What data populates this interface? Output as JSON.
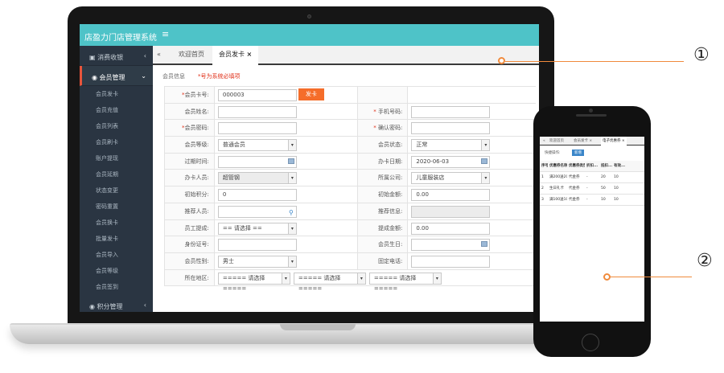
{
  "app": {
    "title": "店盈力门店管理系统",
    "menu_icon": "≡"
  },
  "sidebar": {
    "groups": [
      {
        "label": "消费收银",
        "chev": "‹"
      },
      {
        "label": "会员管理",
        "chev": "⌄"
      },
      {
        "label": "积分管理",
        "chev": "‹"
      }
    ],
    "items": [
      "会员发卡",
      "会员充值",
      "会员列表",
      "会员刷卡",
      "账户提现",
      "会员延期",
      "状态变更",
      "密码重置",
      "会员换卡",
      "批量发卡",
      "会员导入",
      "会员等级",
      "会员签到"
    ]
  },
  "tabs": {
    "back": "«",
    "home": "欢迎首页",
    "active": "会员发卡",
    "close": "×"
  },
  "form": {
    "section": "会员信息",
    "required_note": "*号为系统必填项",
    "issue_button": "发卡",
    "rows": [
      {
        "l1": "会员卡号:",
        "req1": true,
        "v1": "000003",
        "l2": "",
        "v2": ""
      },
      {
        "l1": "会员姓名:",
        "v1": "",
        "l2": "手机号码:",
        "req2": true,
        "v2": ""
      },
      {
        "l1": "会员密码:",
        "req1": true,
        "v1": "",
        "l2": "确认密码:",
        "req2": true,
        "v2": ""
      },
      {
        "l1": "会员等级:",
        "v1": "普通会员",
        "l2": "会员状态:",
        "v2": "正常"
      },
      {
        "l1": "过期时间:",
        "v1": "",
        "l2": "办卡日期:",
        "v2": "2020-06-03"
      },
      {
        "l1": "办卡人员:",
        "v1": "超管钢",
        "l2": "所属公司:",
        "v2": "儿童服装店"
      },
      {
        "l1": "初始积分:",
        "v1": "0",
        "l2": "初始金额:",
        "v2": "0.00"
      },
      {
        "l1": "推荐人员:",
        "v1": "",
        "l2": "推荐信息:",
        "v2": ""
      },
      {
        "l1": "员工提成:",
        "v1": "== 请选择 ==",
        "l2": "提成金额:",
        "v2": "0.00"
      },
      {
        "l1": "身份证号:",
        "v1": "",
        "l2": "会员生日:",
        "v2": ""
      },
      {
        "l1": "会员性别:",
        "v1": "男士",
        "l2": "固定电话:",
        "v2": ""
      },
      {
        "l1": "所在地区:",
        "v1": "===== 请选择 =====",
        "v1b": "===== 请选择 =====",
        "v1c": "===== 请选择 ====="
      }
    ]
  },
  "phone": {
    "tabs": [
      "欢迎首页",
      "会员发卡 ×",
      "电子优惠券 ×"
    ],
    "ops_label": "快捷操作:",
    "new_button": "新增",
    "headers": [
      "序号",
      "优惠券名称",
      "优惠券类型",
      "折扣...",
      "抵扣...",
      "有效..."
    ],
    "rows": [
      [
        "1",
        "满200送20",
        "代金券",
        "-",
        "20",
        "10"
      ],
      [
        "2",
        "生日礼卡",
        "代金券",
        "-",
        "50",
        "10"
      ],
      [
        "3",
        "满100送10",
        "代金券",
        "-",
        "10",
        "10"
      ]
    ]
  },
  "callouts": {
    "one": "①",
    "two": "②"
  }
}
